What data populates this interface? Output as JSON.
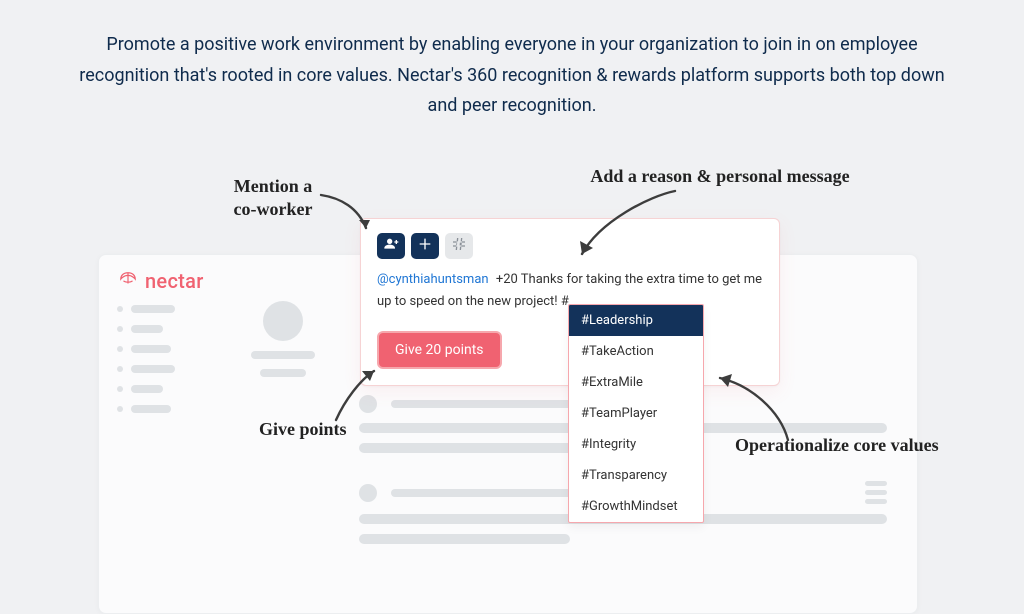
{
  "hero": {
    "paragraph": "Promote a positive work environment by enabling everyone in your organization to join in on employee recognition that's rooted in core values. Nectar's 360 recognition & rewards platform supports both top down and peer recognition."
  },
  "brand": {
    "name": "nectar"
  },
  "compose": {
    "mention": "@cynthiahuntsman",
    "points_text": "+20",
    "message_rest": " Thanks for taking the extra time to get me up to speed on the new project! #",
    "give_button_label": "Give 20 points"
  },
  "hashtags": {
    "items": [
      "#Leadership",
      "#TakeAction",
      "#ExtraMile",
      "#TeamPlayer",
      "#Integrity",
      "#Transparency",
      "#GrowthMindset"
    ],
    "selected_index": 0
  },
  "annotations": {
    "mention": "Mention a\nco-worker",
    "reason": "Add a reason & personal message",
    "points": "Give points",
    "values": "Operationalize core values"
  }
}
